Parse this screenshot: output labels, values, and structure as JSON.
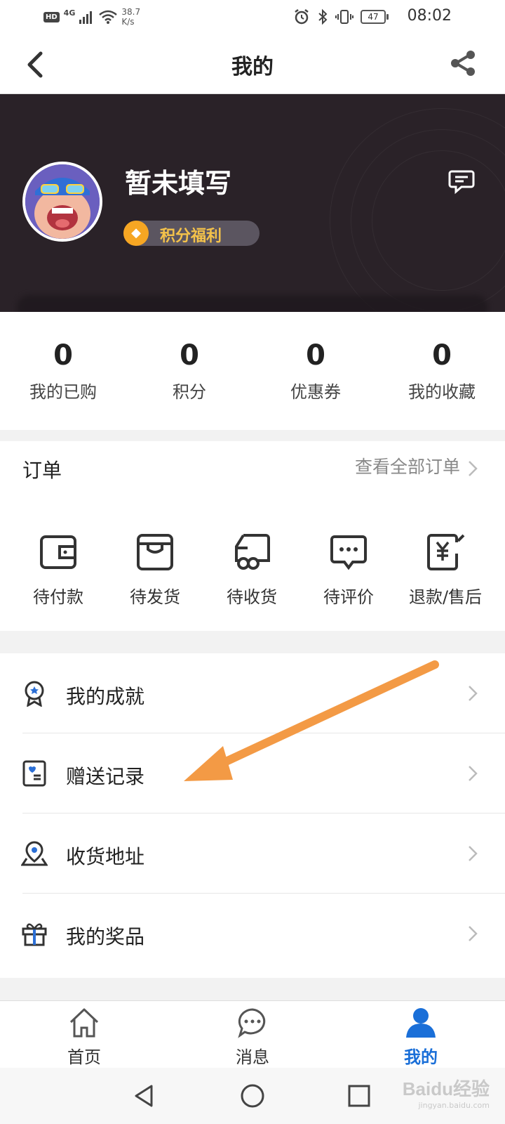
{
  "status_bar": {
    "hd": "HD",
    "net_type": "4G",
    "speed_value": "38.7",
    "speed_unit": "K/s",
    "battery": "47",
    "time": "08:02"
  },
  "header": {
    "title": "我的"
  },
  "profile": {
    "username": "暂未填写",
    "points_badge": "积分福利"
  },
  "stats": [
    {
      "value": "0",
      "label": "我的已购"
    },
    {
      "value": "0",
      "label": "积分"
    },
    {
      "value": "0",
      "label": "优惠券"
    },
    {
      "value": "0",
      "label": "我的收藏"
    }
  ],
  "orders": {
    "title": "订单",
    "view_all": "查看全部订单",
    "items": [
      {
        "label": "待付款",
        "icon": "wallet-icon"
      },
      {
        "label": "待发货",
        "icon": "box-icon"
      },
      {
        "label": "待收货",
        "icon": "truck-icon"
      },
      {
        "label": "待评价",
        "icon": "comment-icon"
      },
      {
        "label": "退款/售后",
        "icon": "refund-icon"
      }
    ]
  },
  "menu": [
    {
      "label": "我的成就",
      "icon": "medal-icon"
    },
    {
      "label": "赠送记录",
      "icon": "gift-record-icon"
    },
    {
      "label": "收货地址",
      "icon": "location-icon"
    },
    {
      "label": "我的奖品",
      "icon": "gift-icon"
    }
  ],
  "tabbar": [
    {
      "label": "首页",
      "icon": "home-icon"
    },
    {
      "label": "消息",
      "icon": "chat-icon"
    },
    {
      "label": "我的",
      "icon": "user-icon",
      "active": true
    }
  ],
  "watermark": {
    "main": "Baidu经验",
    "sub": "jingyan.baidu.com"
  },
  "colors": {
    "accent": "#1a6fd8",
    "banner": "#2a2228",
    "points_text": "#f4c24a",
    "annotation_arrow": "#f39a45"
  }
}
